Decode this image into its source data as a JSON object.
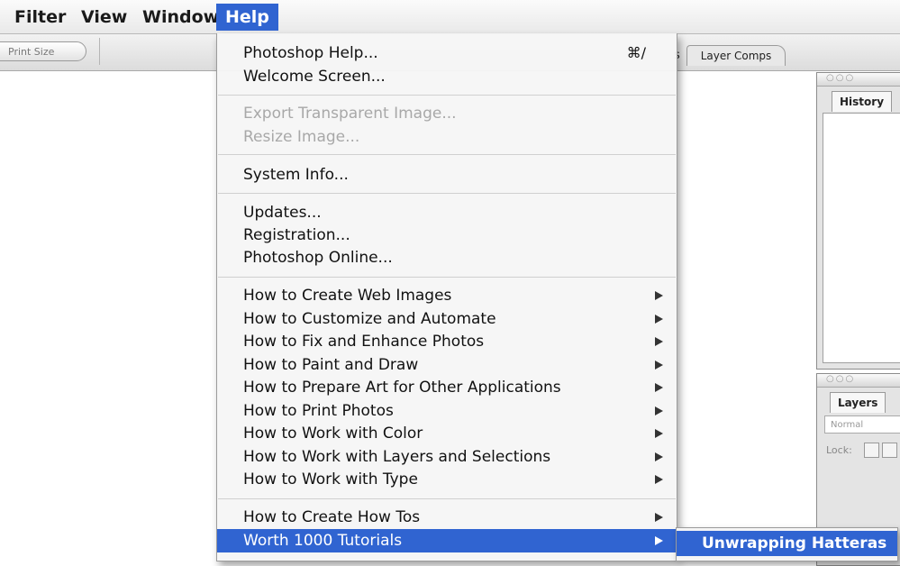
{
  "menubar": {
    "items": [
      {
        "label": "Filter"
      },
      {
        "label": "View"
      },
      {
        "label": "Window"
      },
      {
        "label": "Help"
      }
    ]
  },
  "options_bar": {
    "print_size_label": "Print Size"
  },
  "panel_tabs": {
    "partial_tab": "s",
    "layer_comps": "Layer Comps"
  },
  "palettes": {
    "history": {
      "tab": "History"
    },
    "layers": {
      "tab": "Layers",
      "blend_mode": "Normal",
      "lock_label": "Lock:"
    }
  },
  "help_menu": {
    "photoshop_help": {
      "label": "Photoshop Help...",
      "shortcut": "⌘/"
    },
    "welcome_screen": {
      "label": "Welcome Screen..."
    },
    "export_transparent": {
      "label": "Export Transparent Image..."
    },
    "resize_image": {
      "label": "Resize Image..."
    },
    "system_info": {
      "label": "System Info..."
    },
    "updates": {
      "label": "Updates..."
    },
    "registration": {
      "label": "Registration..."
    },
    "photoshop_online": {
      "label": "Photoshop Online..."
    },
    "howto": [
      "How to Create Web Images",
      "How to Customize and Automate",
      "How to Fix and Enhance Photos",
      "How to Paint and Draw",
      "How to Prepare Art for Other Applications",
      "How to Print Photos",
      "How to Work with Color",
      "How to Work with Layers and Selections",
      "How to Work with Type"
    ],
    "create_how_tos": {
      "label": "How to Create How Tos"
    },
    "worth_1000": {
      "label": "Worth 1000 Tutorials"
    }
  },
  "submenu": {
    "item": "Unwrapping Hatteras"
  },
  "colors": {
    "selection": "#3064d1",
    "menu_bg": "#f6f6f6",
    "disabled_text": "#a8a8a8"
  }
}
